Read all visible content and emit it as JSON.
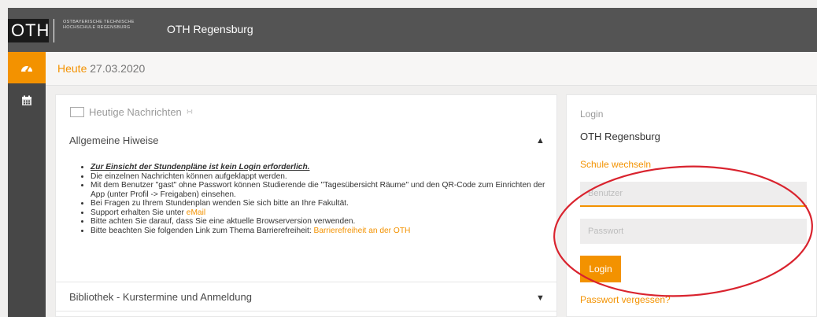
{
  "header": {
    "logo": "OTH",
    "logo_sub": "OSTBAYERISCHE TECHNISCHE HOCHSCHULE REGENSBURG",
    "app_title": "OTH Regensburg"
  },
  "sidebar": {
    "items": [
      {
        "icon": "dashboard-icon",
        "active": true
      },
      {
        "icon": "calendar-icon",
        "active": false
      }
    ]
  },
  "date_bar": {
    "label": "Heute",
    "date": "27.03.2020"
  },
  "news": {
    "header": "Heutige Nachrichten",
    "section_title": "Allgemeine Hiweise",
    "bullets": [
      "Zur Einsicht der Stundenpläne ist kein Login erforderlich.",
      "Die einzelnen Nachrichten können aufgeklappt werden.",
      "Mit dem Benutzer \"gast\" ohne Passwort können Studierende die \"Tagesübersicht Räume\" und den QR-Code zum Einrichten der App (unter Profil -> Freigaben) einsehen.",
      "Bei Fragen zu Ihrem Stundenplan wenden Sie sich bitte an Ihre Fakultät.",
      "Support erhalten Sie unter",
      "Bitte achten Sie darauf, dass Sie eine aktuelle Browserversion verwenden.",
      "Bitte beachten Sie folgenden Link zum Thema Barrierefreiheit:"
    ],
    "support_link": "eMail",
    "barrier_link": "Barrierefreiheit an der OTH",
    "next_section": "Bibliothek - Kurstermine und Anmeldung"
  },
  "login": {
    "title": "Login",
    "school": "OTH Regensburg",
    "switch_school": "Schule wechseln",
    "user_placeholder": "Benutzer",
    "pass_placeholder": "Passwort",
    "button": "Login",
    "forgot": "Passwort vergessen?"
  },
  "colors": {
    "accent": "#f39200",
    "header_bg": "#545454",
    "sidebar_bg": "#474747",
    "annotation": "#d9232e"
  }
}
